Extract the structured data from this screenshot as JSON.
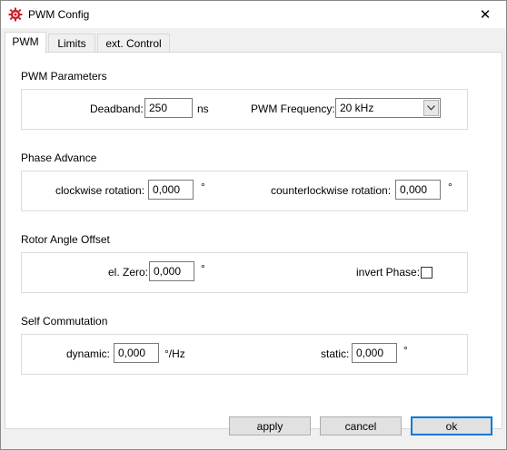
{
  "window": {
    "title": "PWM Config",
    "close_glyph": "✕"
  },
  "tabs": [
    {
      "label": "PWM",
      "active": true
    },
    {
      "label": "Limits",
      "active": false
    },
    {
      "label": "ext. Control",
      "active": false
    }
  ],
  "pwm_parameters": {
    "title": "PWM Parameters",
    "deadband_label": "Deadband:",
    "deadband_value": "250",
    "deadband_unit": "ns",
    "frequency_label": "PWM Frequency:",
    "frequency_value": "20 kHz"
  },
  "phase_advance": {
    "title": "Phase Advance",
    "cw_label": "clockwise rotation:",
    "cw_value": "0,000",
    "cw_unit": "°",
    "ccw_label": "counterlockwise rotation:",
    "ccw_value": "0,000",
    "ccw_unit": "°"
  },
  "rotor_angle_offset": {
    "title": "Rotor Angle Offset",
    "zero_label": "el. Zero:",
    "zero_value": "0,000",
    "zero_unit": "°",
    "invert_label": "invert Phase:",
    "invert_checked": false
  },
  "self_commutation": {
    "title": "Self Commutation",
    "dynamic_label": "dynamic:",
    "dynamic_value": "0,000",
    "dynamic_unit": "°/Hz",
    "static_label": "static:",
    "static_value": "0,000",
    "static_unit": "°"
  },
  "buttons": {
    "apply": "apply",
    "cancel": "cancel",
    "ok": "ok"
  },
  "colors": {
    "accent": "#0078d7",
    "icon_red": "#c8202c"
  },
  "icons": {
    "app": "gear-app-icon",
    "dropdown": "chevron-down-icon"
  }
}
